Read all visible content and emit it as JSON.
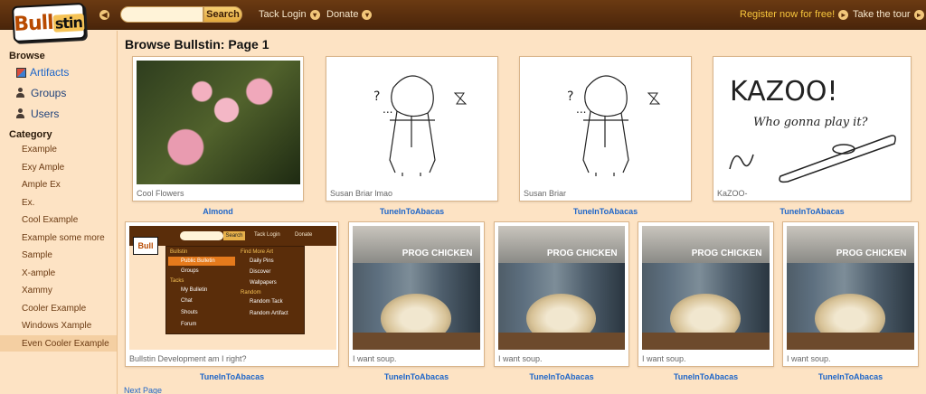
{
  "logo": {
    "text": "Bull",
    "badge": "stin"
  },
  "search": {
    "placeholder": "",
    "button_label": "Search"
  },
  "topnav": {
    "tack_login": "Tack Login",
    "donate": "Donate",
    "register": "Register now for free!",
    "tour": "Take the tour"
  },
  "icons": {
    "back": "arrow-left-icon",
    "dropdown": "chevron-down-icon",
    "go": "arrow-right-icon"
  },
  "sidebar": {
    "browse_heading": "Browse",
    "browse_items": [
      {
        "label": "Artifacts"
      },
      {
        "label": "Groups"
      },
      {
        "label": "Users"
      }
    ],
    "category_heading": "Category",
    "categories": [
      "Example",
      "Exy Ample",
      "Ample Ex",
      "Ex.",
      "Cool Example",
      "Example some more",
      "Sample",
      "X-ample",
      "Xammy",
      "Cooler Example",
      "Windows Xample",
      "Even Cooler Example"
    ],
    "selected_category": "Even Cooler Example"
  },
  "main": {
    "title": "Browse Bullstin: Page 1",
    "next_page": "Next Page",
    "cards": [
      {
        "caption": "Cool Flowers",
        "author": "Almond"
      },
      {
        "caption": "Susan Briar lmao",
        "author": "TuneInToAbacas"
      },
      {
        "caption": "Susan Briar",
        "author": "TuneInToAbacas"
      },
      {
        "caption": "KaZOO-",
        "author": "TuneInToAbacas"
      },
      {
        "caption": "Bullstin Development am I right?",
        "author": "TuneInToAbacas"
      },
      {
        "caption": "I want soup.",
        "author": "TuneInToAbacas"
      },
      {
        "caption": "I want soup.",
        "author": "TuneInToAbacas"
      },
      {
        "caption": "I want soup.",
        "author": "TuneInToAbacas"
      },
      {
        "caption": "I want soup.",
        "author": "TuneInToAbacas"
      }
    ],
    "kazoo_text": "KAZOO!",
    "kazoo_sub": "Who gonna play it?",
    "soup_label": "PROG CHICKEN",
    "screenshot_menu": {
      "col1_head": "Bullstin",
      "col1": [
        "Public Bulletin",
        "Groups"
      ],
      "col1b_head": "Tacks",
      "col1b": [
        "My Bulletin",
        "Chat",
        "Shouts",
        "Forum"
      ],
      "col2_head": "Find More Art",
      "col2": [
        "Daily Pins",
        "Discover",
        "Wallpapers"
      ],
      "col2b_head": "Random",
      "col2b": [
        "Random Tack",
        "Random Artifact"
      ]
    }
  }
}
